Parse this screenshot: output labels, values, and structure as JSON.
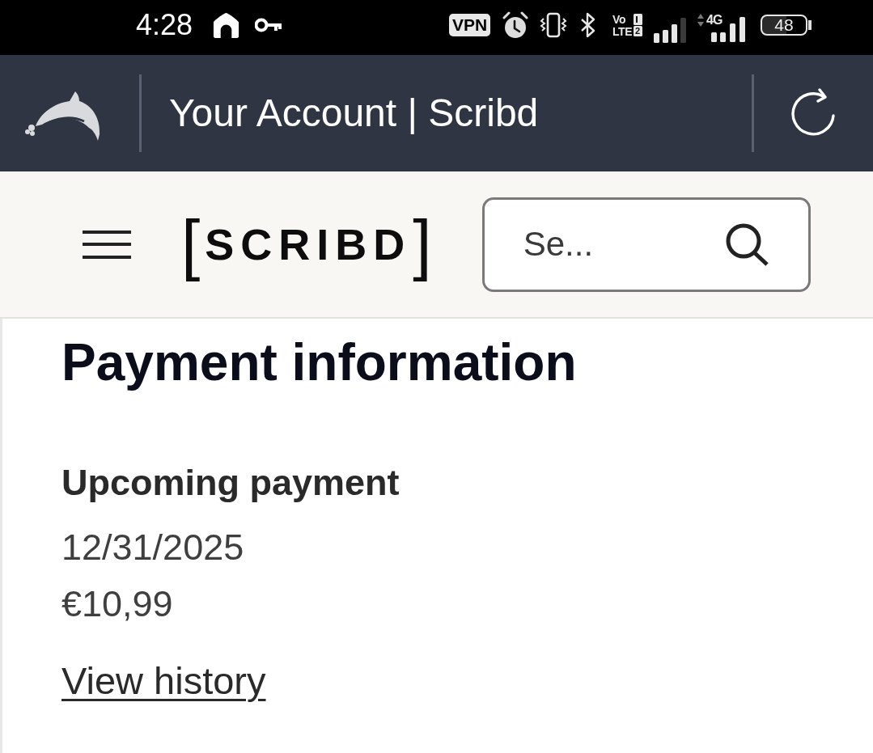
{
  "status_bar": {
    "time": "4:28",
    "vpn": "VPN",
    "volte_top": "Vo",
    "volte_bottom": "LTE",
    "sim": "2",
    "network": "4G",
    "battery": "48"
  },
  "browser_bar": {
    "title": "Your Account | Scribd"
  },
  "site_header": {
    "logo": {
      "open": "[",
      "text": "SCRIBD",
      "close": "]"
    },
    "search": {
      "placeholder": "Se..."
    }
  },
  "content": {
    "heading": "Payment information",
    "section_title": "Upcoming payment",
    "date": "12/31/2025",
    "amount": "€10,99",
    "link": "View history"
  }
}
